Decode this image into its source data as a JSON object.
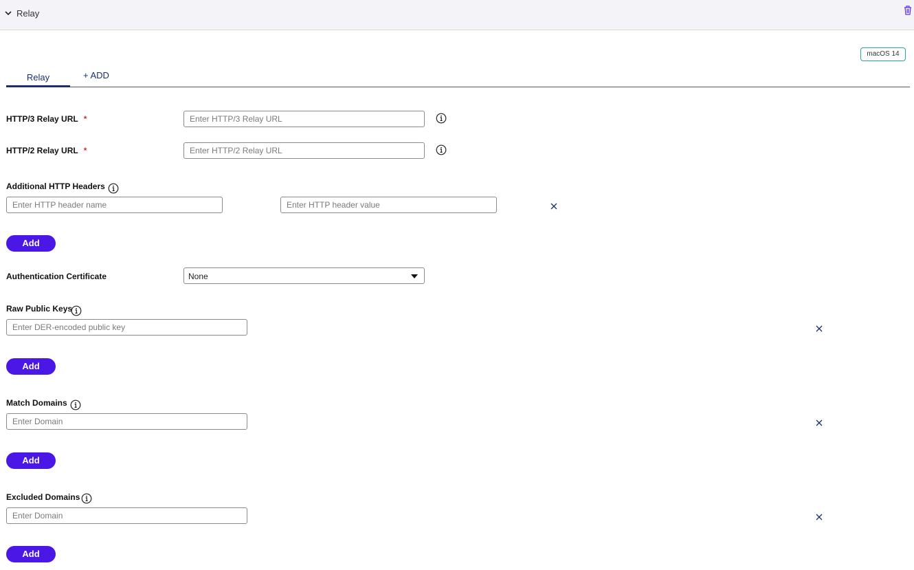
{
  "header": {
    "title": "Relay"
  },
  "badge": {
    "os": "macOS 14"
  },
  "tabs": {
    "relay": "Relay",
    "add": "+ ADD"
  },
  "http3": {
    "label": "HTTP/3 Relay URL",
    "required": "*",
    "placeholder": "Enter HTTP/3 Relay URL"
  },
  "http2": {
    "label": "HTTP/2 Relay URL",
    "required": "*",
    "placeholder": "Enter HTTP/2 Relay URL"
  },
  "headers": {
    "label": "Additional HTTP Headers",
    "name_placeholder": "Enter HTTP header name",
    "value_placeholder": "Enter HTTP header value",
    "add_label": "Add"
  },
  "auth_cert": {
    "label": "Authentication Certificate",
    "value": "None"
  },
  "raw_keys": {
    "label": "Raw Public Keys",
    "placeholder": "Enter DER-encoded public key",
    "add_label": "Add"
  },
  "match_domains": {
    "label": "Match Domains",
    "placeholder": "Enter Domain",
    "add_label": "Add"
  },
  "excluded_domains": {
    "label": "Excluded Domains",
    "placeholder": "Enter Domain",
    "add_label": "Add"
  },
  "colors": {
    "primary": "#4a17e6",
    "tab_accent": "#1c2e6b",
    "badge_border": "#2aa3a3",
    "required": "#c0392b"
  }
}
